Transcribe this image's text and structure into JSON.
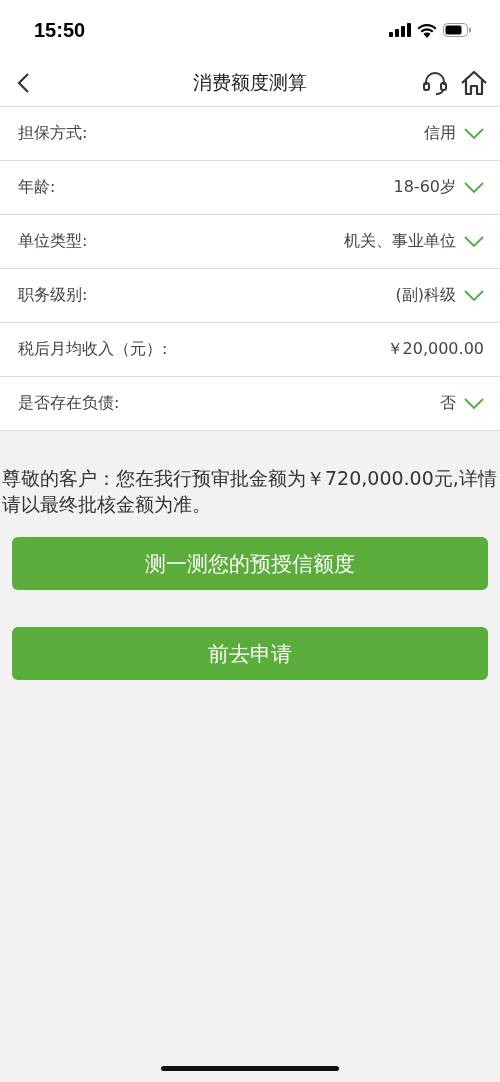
{
  "status_bar": {
    "time": "15:50"
  },
  "nav": {
    "title": "消费额度测算"
  },
  "fields": [
    {
      "label": "担保方式:",
      "value": "信用",
      "kind": "select"
    },
    {
      "label": "年龄:",
      "value": "18-60岁",
      "kind": "select"
    },
    {
      "label": "单位类型:",
      "value": "机关、事业单位",
      "kind": "select"
    },
    {
      "label": "职务级别:",
      "value": "(副)科级",
      "kind": "select"
    },
    {
      "label": "税后月均收入（元）:",
      "value": "￥20,000.00",
      "kind": "text"
    },
    {
      "label": "是否存在负债:",
      "value": "否",
      "kind": "select"
    }
  ],
  "notice": "尊敬的客户：您在我行预审批金额为￥720,000.00元,详情请以最终批核金额为准。",
  "buttons": [
    "测一测您的预授信额度",
    "前去申请"
  ]
}
